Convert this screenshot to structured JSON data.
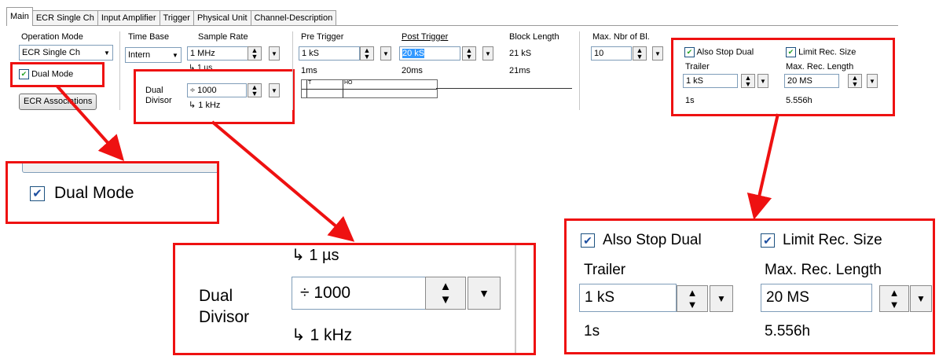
{
  "tabs": [
    "Main",
    "ECR Single Ch",
    "Input Amplifier",
    "Trigger",
    "Physical Unit",
    "Channel-Description"
  ],
  "main": {
    "operation_mode": {
      "label": "Operation Mode",
      "value": "ECR Single Ch"
    },
    "dual_mode": {
      "label": "Dual Mode",
      "checked": true
    },
    "ecr_associations_label": "ECR Associations",
    "time_base": {
      "label": "Time Base",
      "value": "Intern"
    },
    "sample_rate": {
      "label": "Sample Rate",
      "value": "1 MHz",
      "period": "1 µs"
    },
    "dual_divisor": {
      "label_line1": "Dual",
      "label_line2": "Divisor",
      "value": "÷ 1000",
      "result": "1 kHz"
    },
    "pre_trigger": {
      "label": "Pre Trigger",
      "value": "1 kS",
      "time": "1ms"
    },
    "post_trigger": {
      "label": "Post Trigger",
      "value": "20 kS",
      "time": "20ms"
    },
    "block_length": {
      "label": "Block Length",
      "value": "21 kS",
      "time": "21ms"
    },
    "trigger_graph": {
      "marker_t": "T",
      "marker_ho": "HO"
    },
    "max_blocks": {
      "label": "Max. Nbr of Bl.",
      "value": "10"
    },
    "also_stop_dual": {
      "label": "Also Stop Dual",
      "checked": true
    },
    "trailer": {
      "label": "Trailer",
      "value": "1 kS",
      "time": "1s"
    },
    "limit_rec_size": {
      "label": "Limit Rec. Size",
      "checked": true
    },
    "max_rec_length": {
      "label": "Max. Rec. Length",
      "value": "20 MS",
      "time": "5.556h"
    }
  },
  "colors": {
    "highlight": "#ee1111",
    "selection": "#3399ff",
    "check": "#21a121"
  },
  "icons": {
    "spin": "spin-updown-icon",
    "dropdown": "chevron-down-icon",
    "divider": "divide-icon",
    "rate_arrow": "curved-arrow-icon"
  }
}
